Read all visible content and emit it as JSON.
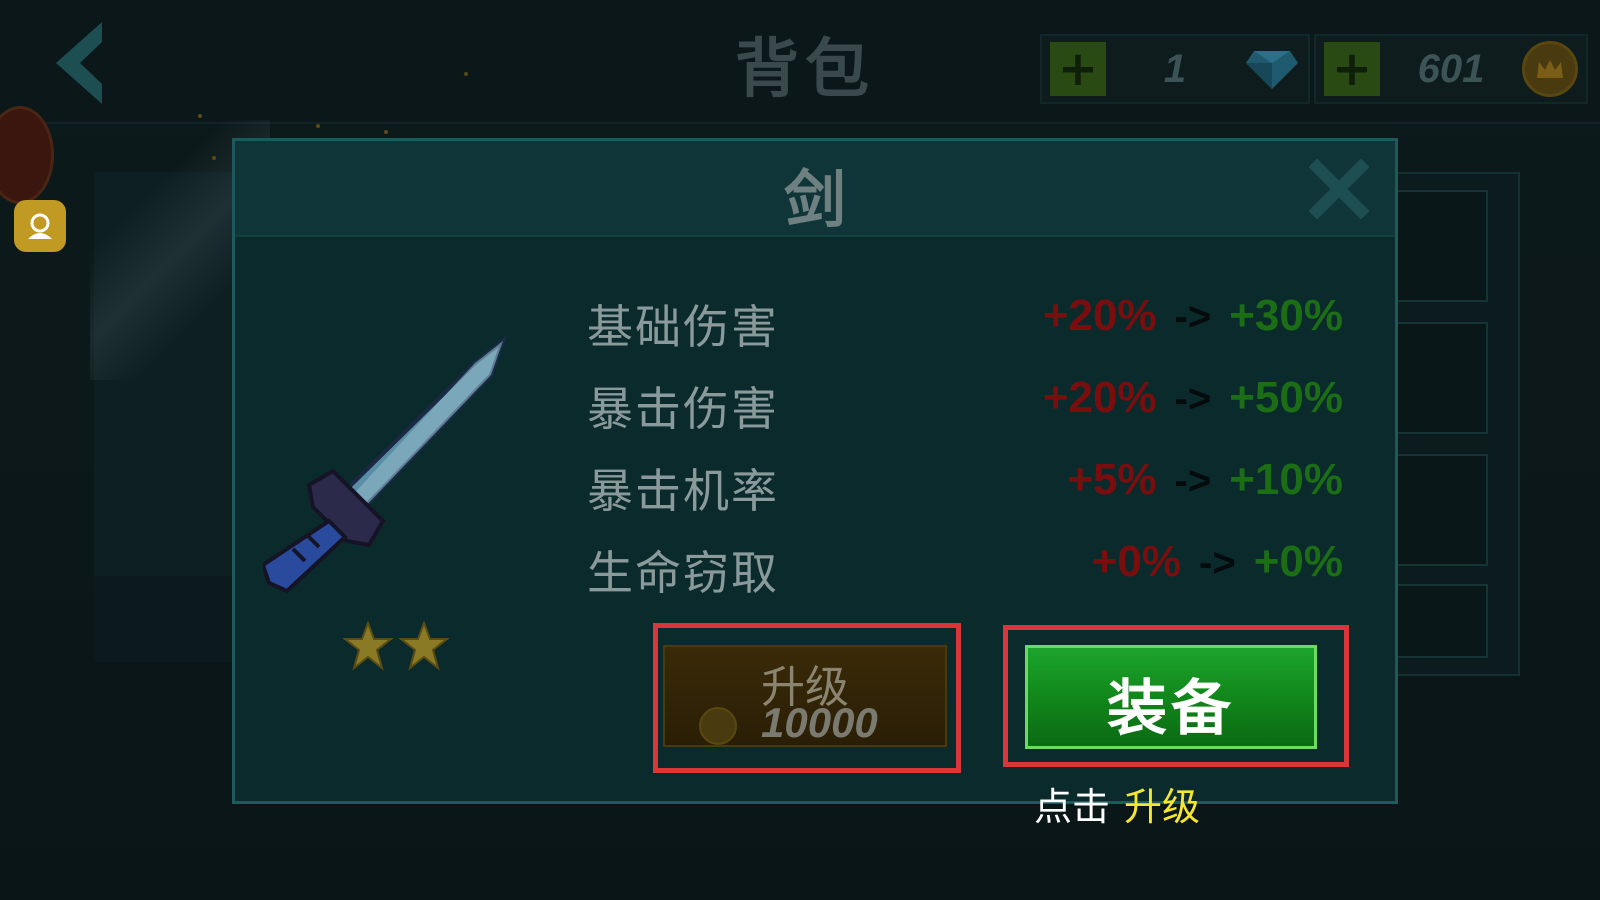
{
  "header": {
    "title": "背包",
    "gems": {
      "value": "1"
    },
    "coins": {
      "value": "601"
    }
  },
  "modal": {
    "title": "剑",
    "stars": 2,
    "stats": [
      {
        "label": "基础伤害",
        "old": "+20%",
        "arrow": "->",
        "new": "+30%"
      },
      {
        "label": "暴击伤害",
        "old": "+20%",
        "arrow": "->",
        "new": "+50%"
      },
      {
        "label": "暴击机率",
        "old": "+5%",
        "arrow": "->",
        "new": "+10%"
      },
      {
        "label": "生命窃取",
        "old": "+0%",
        "arrow": "->",
        "new": "+0%"
      }
    ],
    "upgrade": {
      "label": "升级",
      "cost": "10000"
    },
    "equip": {
      "label": "装备"
    }
  },
  "hint": {
    "prefix": "点击",
    "action": "升级"
  },
  "colors": {
    "old_value": "#7a0e0e",
    "new_value": "#1b6e16",
    "highlight_frame": "#d9353b",
    "hint_action": "#f4e631"
  }
}
